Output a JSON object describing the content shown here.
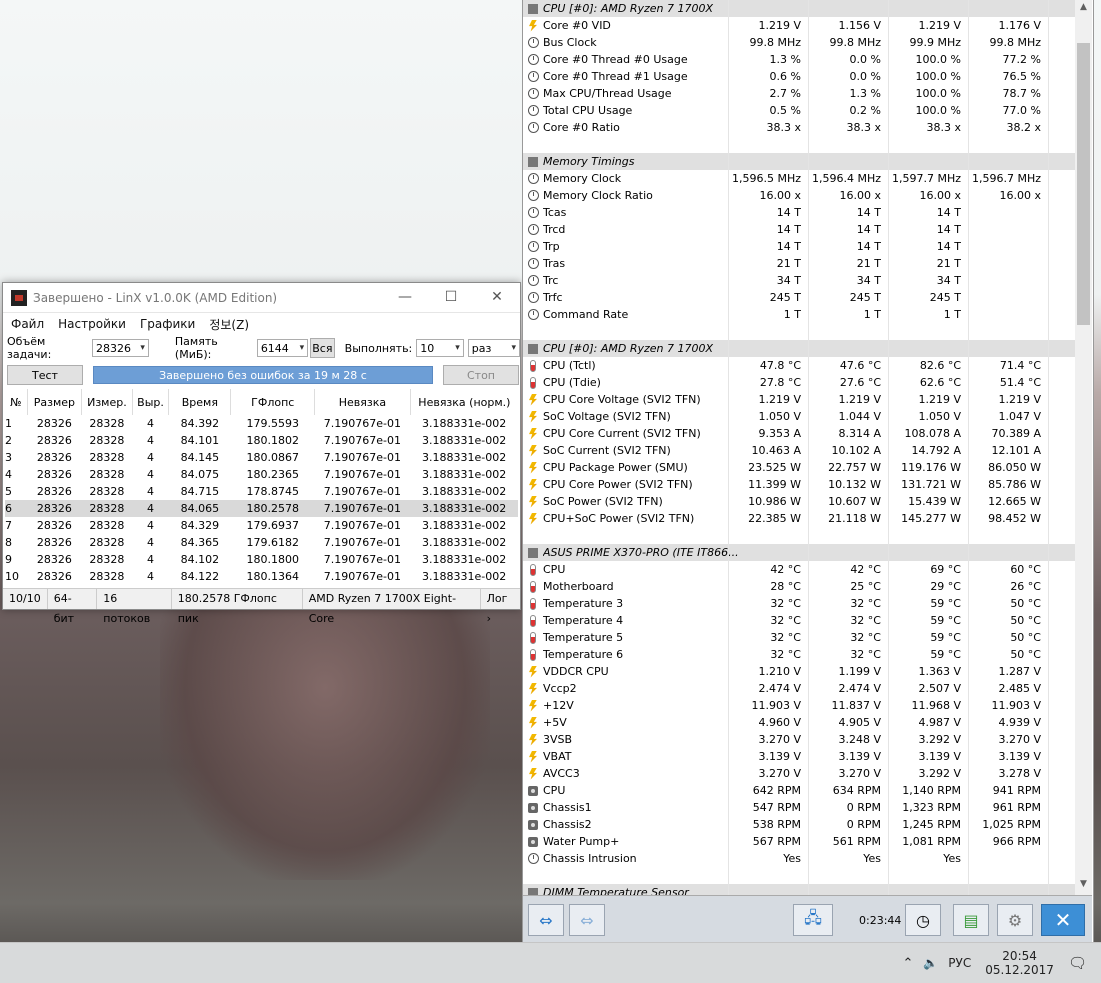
{
  "linx": {
    "title": "Завершено - LinX v1.0.0K (AMD Edition)",
    "menu": [
      "Файл",
      "Настройки",
      "Графики",
      "정보(Z)"
    ],
    "task_label": "Объём задачи:",
    "task_value": "28326",
    "memory_label": "Память (МиБ):",
    "memory_value": "6144",
    "all_button": "Вся",
    "run_label": "Выполнять:",
    "run_value": "10",
    "run_unit": "раз",
    "test_button": "Тест",
    "progress_text": "Завершено без ошибок за 19 м 28 с",
    "progress": 1.0,
    "stop_button": "Стоп",
    "columns": [
      "№",
      "Размер",
      "Измер.",
      "Выр.",
      "Время",
      "ГФлопс",
      "Невязка",
      "Невязка (норм.)"
    ],
    "rows": [
      [
        "1",
        "28326",
        "28328",
        "4",
        "84.392",
        "179.5593",
        "7.190767e-01",
        "3.188331e-002"
      ],
      [
        "2",
        "28326",
        "28328",
        "4",
        "84.101",
        "180.1802",
        "7.190767e-01",
        "3.188331e-002"
      ],
      [
        "3",
        "28326",
        "28328",
        "4",
        "84.145",
        "180.0867",
        "7.190767e-01",
        "3.188331e-002"
      ],
      [
        "4",
        "28326",
        "28328",
        "4",
        "84.075",
        "180.2365",
        "7.190767e-01",
        "3.188331e-002"
      ],
      [
        "5",
        "28326",
        "28328",
        "4",
        "84.715",
        "178.8745",
        "7.190767e-01",
        "3.188331e-002"
      ],
      [
        "6",
        "28326",
        "28328",
        "4",
        "84.065",
        "180.2578",
        "7.190767e-01",
        "3.188331e-002"
      ],
      [
        "7",
        "28326",
        "28328",
        "4",
        "84.329",
        "179.6937",
        "7.190767e-01",
        "3.188331e-002"
      ],
      [
        "8",
        "28326",
        "28328",
        "4",
        "84.365",
        "179.6182",
        "7.190767e-01",
        "3.188331e-002"
      ],
      [
        "9",
        "28326",
        "28328",
        "4",
        "84.102",
        "180.1800",
        "7.190767e-01",
        "3.188331e-002"
      ],
      [
        "10",
        "28326",
        "28328",
        "4",
        "84.122",
        "180.1364",
        "7.190767e-01",
        "3.188331e-002"
      ]
    ],
    "highlighted_row": 6,
    "status": [
      "10/10",
      "64-бит",
      "16 потоков",
      "180.2578 ГФлопс пик",
      "AMD Ryzen 7 1700X Eight-Core",
      "Лог ›"
    ]
  },
  "hwinfo": {
    "rows": [
      {
        "type": "section",
        "name": "CPU [#0]: AMD Ryzen 7 1700X"
      },
      {
        "icon": "bolt",
        "name": "Core #0 VID",
        "v": [
          "1.219 V",
          "1.156 V",
          "1.219 V",
          "1.176 V"
        ]
      },
      {
        "icon": "clock",
        "name": "Bus Clock",
        "v": [
          "99.8 MHz",
          "99.8 MHz",
          "99.9 MHz",
          "99.8 MHz"
        ]
      },
      {
        "icon": "clock",
        "name": "Core #0 Thread #0 Usage",
        "v": [
          "1.3 %",
          "0.0 %",
          "100.0 %",
          "77.2 %"
        ]
      },
      {
        "icon": "clock",
        "name": "Core #0 Thread #1 Usage",
        "v": [
          "0.6 %",
          "0.0 %",
          "100.0 %",
          "76.5 %"
        ]
      },
      {
        "icon": "clock",
        "name": "Max CPU/Thread Usage",
        "v": [
          "2.7 %",
          "1.3 %",
          "100.0 %",
          "78.7 %"
        ]
      },
      {
        "icon": "clock",
        "name": "Total CPU Usage",
        "v": [
          "0.5 %",
          "0.2 %",
          "100.0 %",
          "77.0 %"
        ]
      },
      {
        "icon": "clock",
        "name": "Core #0 Ratio",
        "v": [
          "38.3 x",
          "38.3 x",
          "38.3 x",
          "38.2 x"
        ]
      },
      {
        "type": "blank"
      },
      {
        "type": "section",
        "name": "Memory Timings"
      },
      {
        "icon": "clock",
        "name": "Memory Clock",
        "v": [
          "1,596.5 MHz",
          "1,596.4 MHz",
          "1,597.7 MHz",
          "1,596.7 MHz"
        ]
      },
      {
        "icon": "clock",
        "name": "Memory Clock Ratio",
        "v": [
          "16.00 x",
          "16.00 x",
          "16.00 x",
          "16.00 x"
        ]
      },
      {
        "icon": "clock",
        "name": "Tcas",
        "v": [
          "14 T",
          "14 T",
          "14 T",
          ""
        ]
      },
      {
        "icon": "clock",
        "name": "Trcd",
        "v": [
          "14 T",
          "14 T",
          "14 T",
          ""
        ]
      },
      {
        "icon": "clock",
        "name": "Trp",
        "v": [
          "14 T",
          "14 T",
          "14 T",
          ""
        ]
      },
      {
        "icon": "clock",
        "name": "Tras",
        "v": [
          "21 T",
          "21 T",
          "21 T",
          ""
        ]
      },
      {
        "icon": "clock",
        "name": "Trc",
        "v": [
          "34 T",
          "34 T",
          "34 T",
          ""
        ]
      },
      {
        "icon": "clock",
        "name": "Trfc",
        "v": [
          "245 T",
          "245 T",
          "245 T",
          ""
        ]
      },
      {
        "icon": "clock",
        "name": "Command Rate",
        "v": [
          "1 T",
          "1 T",
          "1 T",
          ""
        ]
      },
      {
        "type": "blank"
      },
      {
        "type": "section",
        "name": "CPU [#0]: AMD Ryzen 7 1700X"
      },
      {
        "icon": "therm",
        "name": "CPU (Tctl)",
        "v": [
          "47.8 °C",
          "47.6 °C",
          "82.6 °C",
          "71.4 °C"
        ]
      },
      {
        "icon": "therm",
        "name": "CPU (Tdie)",
        "v": [
          "27.8 °C",
          "27.6 °C",
          "62.6 °C",
          "51.4 °C"
        ]
      },
      {
        "icon": "bolt",
        "name": "CPU Core Voltage (SVI2 TFN)",
        "v": [
          "1.219 V",
          "1.219 V",
          "1.219 V",
          "1.219 V"
        ]
      },
      {
        "icon": "bolt",
        "name": "SoC Voltage (SVI2 TFN)",
        "v": [
          "1.050 V",
          "1.044 V",
          "1.050 V",
          "1.047 V"
        ]
      },
      {
        "icon": "bolt",
        "name": "CPU Core Current (SVI2 TFN)",
        "v": [
          "9.353 A",
          "8.314 A",
          "108.078 A",
          "70.389 A"
        ]
      },
      {
        "icon": "bolt",
        "name": "SoC Current (SVI2 TFN)",
        "v": [
          "10.463 A",
          "10.102 A",
          "14.792 A",
          "12.101 A"
        ]
      },
      {
        "icon": "bolt",
        "name": "CPU Package Power (SMU)",
        "v": [
          "23.525 W",
          "22.757 W",
          "119.176 W",
          "86.050 W"
        ]
      },
      {
        "icon": "bolt",
        "name": "CPU Core Power (SVI2 TFN)",
        "v": [
          "11.399 W",
          "10.132 W",
          "131.721 W",
          "85.786 W"
        ]
      },
      {
        "icon": "bolt",
        "name": "SoC Power (SVI2 TFN)",
        "v": [
          "10.986 W",
          "10.607 W",
          "15.439 W",
          "12.665 W"
        ]
      },
      {
        "icon": "bolt",
        "name": "CPU+SoC Power (SVI2 TFN)",
        "v": [
          "22.385 W",
          "21.118 W",
          "145.277 W",
          "98.452 W"
        ]
      },
      {
        "type": "blank"
      },
      {
        "type": "section",
        "name": "ASUS PRIME X370-PRO (ITE IT866..."
      },
      {
        "icon": "therm",
        "name": "CPU",
        "v": [
          "42 °C",
          "42 °C",
          "69 °C",
          "60 °C"
        ]
      },
      {
        "icon": "therm",
        "name": "Motherboard",
        "v": [
          "28 °C",
          "25 °C",
          "29 °C",
          "26 °C"
        ]
      },
      {
        "icon": "therm",
        "name": "Temperature 3",
        "v": [
          "32 °C",
          "32 °C",
          "59 °C",
          "50 °C"
        ]
      },
      {
        "icon": "therm",
        "name": "Temperature 4",
        "v": [
          "32 °C",
          "32 °C",
          "59 °C",
          "50 °C"
        ]
      },
      {
        "icon": "therm",
        "name": "Temperature 5",
        "v": [
          "32 °C",
          "32 °C",
          "59 °C",
          "50 °C"
        ]
      },
      {
        "icon": "therm",
        "name": "Temperature 6",
        "v": [
          "32 °C",
          "32 °C",
          "59 °C",
          "50 °C"
        ]
      },
      {
        "icon": "bolt",
        "name": "VDDCR CPU",
        "v": [
          "1.210 V",
          "1.199 V",
          "1.363 V",
          "1.287 V"
        ]
      },
      {
        "icon": "bolt",
        "name": "Vccp2",
        "v": [
          "2.474 V",
          "2.474 V",
          "2.507 V",
          "2.485 V"
        ]
      },
      {
        "icon": "bolt",
        "name": "+12V",
        "v": [
          "11.903 V",
          "11.837 V",
          "11.968 V",
          "11.903 V"
        ]
      },
      {
        "icon": "bolt",
        "name": "+5V",
        "v": [
          "4.960 V",
          "4.905 V",
          "4.987 V",
          "4.939 V"
        ]
      },
      {
        "icon": "bolt",
        "name": "3VSB",
        "v": [
          "3.270 V",
          "3.248 V",
          "3.292 V",
          "3.270 V"
        ]
      },
      {
        "icon": "bolt",
        "name": "VBAT",
        "v": [
          "3.139 V",
          "3.139 V",
          "3.139 V",
          "3.139 V"
        ]
      },
      {
        "icon": "bolt",
        "name": "AVCC3",
        "v": [
          "3.270 V",
          "3.270 V",
          "3.292 V",
          "3.278 V"
        ]
      },
      {
        "icon": "fan",
        "name": "CPU",
        "v": [
          "642 RPM",
          "634 RPM",
          "1,140 RPM",
          "941 RPM"
        ]
      },
      {
        "icon": "fan",
        "name": "Chassis1",
        "v": [
          "547 RPM",
          "0 RPM",
          "1,323 RPM",
          "961 RPM"
        ]
      },
      {
        "icon": "fan",
        "name": "Chassis2",
        "v": [
          "538 RPM",
          "0 RPM",
          "1,245 RPM",
          "1,025 RPM"
        ]
      },
      {
        "icon": "fan",
        "name": "Water Pump+",
        "v": [
          "567 RPM",
          "561 RPM",
          "1,081 RPM",
          "966 RPM"
        ]
      },
      {
        "icon": "clock",
        "name": "Chassis Intrusion",
        "v": [
          "Yes",
          "Yes",
          "Yes",
          ""
        ]
      },
      {
        "type": "blank"
      },
      {
        "type": "section",
        "name": "DIMM Temperature Sensor"
      }
    ],
    "timer": "0:23:44"
  },
  "taskbar": {
    "lang": "РУС",
    "time": "20:54",
    "date": "05.12.2017"
  }
}
